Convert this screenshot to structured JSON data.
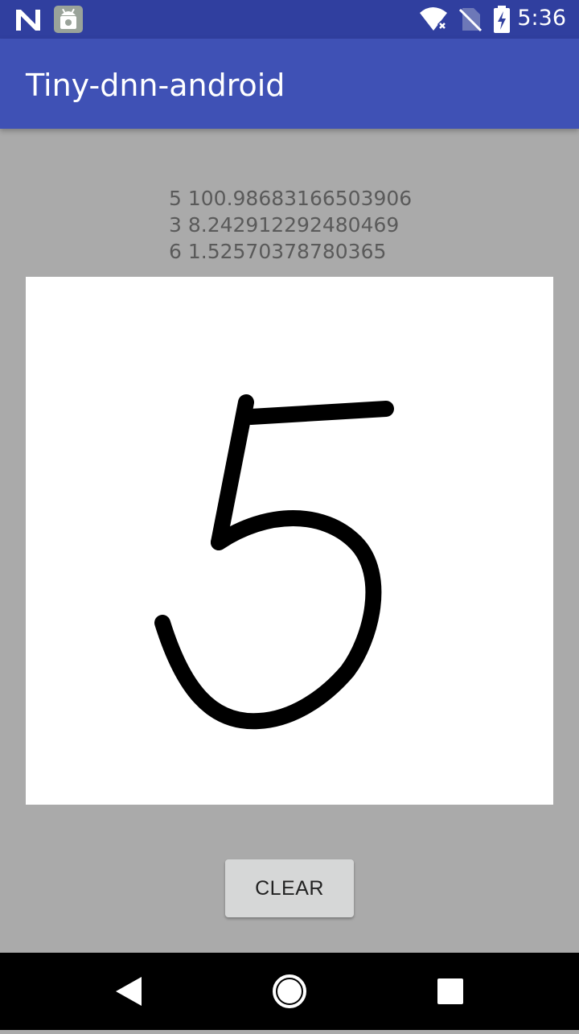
{
  "status_bar": {
    "time": "5:36",
    "icons": [
      "notification-n-icon",
      "android-debug-icon",
      "wifi-icon",
      "no-sim-icon",
      "battery-charging-icon"
    ]
  },
  "app_bar": {
    "title": "Tiny-dnn-android"
  },
  "results": {
    "lines": [
      "5 100.98683166503906",
      "3 8.242912292480469",
      "6 1.52570378780365"
    ]
  },
  "canvas": {
    "drawn_digit": "5",
    "stroke_color": "#000000"
  },
  "clear_button": {
    "label": "CLEAR"
  },
  "nav_bar": {
    "icons": [
      "back-icon",
      "home-icon",
      "recents-icon"
    ]
  },
  "colors": {
    "status_bar": "#303f9f",
    "app_bar": "#3f51b5",
    "background": "#aaaaaa",
    "canvas": "#ffffff",
    "button": "#d6d7d7"
  }
}
